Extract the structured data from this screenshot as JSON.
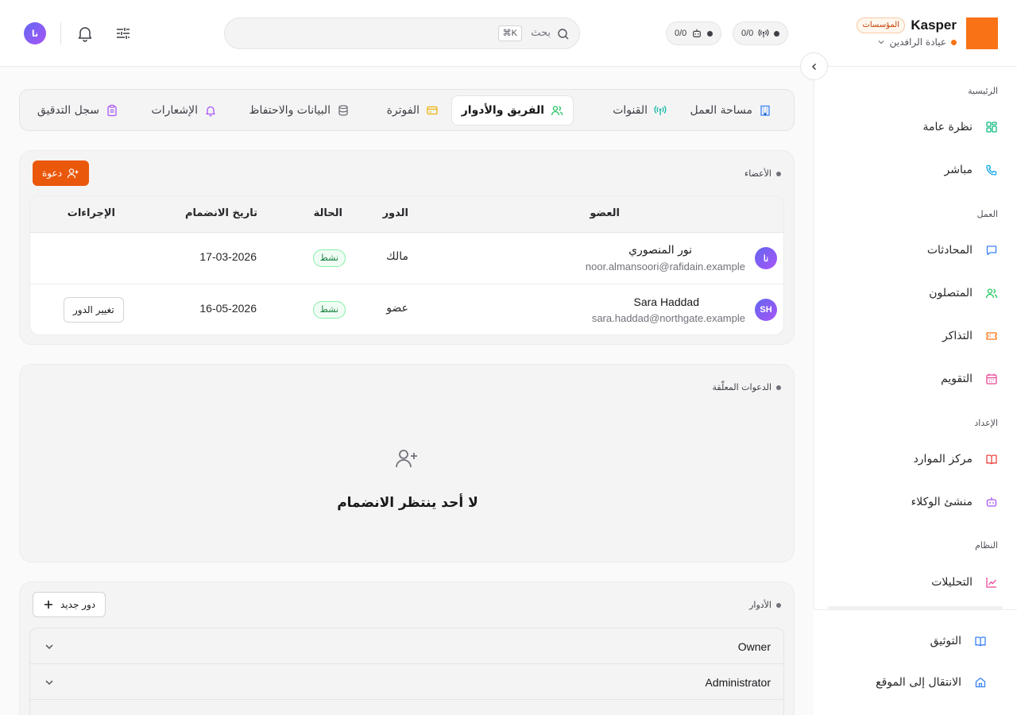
{
  "header": {
    "brand": "Kasper",
    "plan_badge": "المؤسسات",
    "clinic": "عيادة الرافدين",
    "pill_signal": "0/0",
    "pill_bot": "0/0",
    "search_placeholder": "بحث",
    "search_shortcut": "⌘K",
    "user_initials": "نا",
    "accent_color": "#f97316"
  },
  "sidebar": {
    "sections": [
      {
        "label": "الرئيسية"
      },
      {
        "label": "العمل"
      },
      {
        "label": "الإعداد"
      },
      {
        "label": "النظام"
      }
    ],
    "items": [
      {
        "label": "نظرة عامة",
        "icon": "grid-icon"
      },
      {
        "label": "مباشر",
        "icon": "phone-icon"
      },
      {
        "label": "المحادثات",
        "icon": "chat-icon"
      },
      {
        "label": "المتصلون",
        "icon": "users-icon"
      },
      {
        "label": "التذاكر",
        "icon": "ticket-icon"
      },
      {
        "label": "التقويم",
        "icon": "calendar-icon"
      },
      {
        "label": "مركز الموارد",
        "icon": "book-icon"
      },
      {
        "label": "منشئ الوكلاء",
        "icon": "bot-icon"
      },
      {
        "label": "التحليلات",
        "icon": "chart-icon"
      }
    ],
    "footer": [
      {
        "label": "التوثيق",
        "icon": "book-open-icon"
      },
      {
        "label": "الانتقال إلى الموقع",
        "icon": "home-icon"
      }
    ]
  },
  "tabs": [
    {
      "label": "مساحة العمل",
      "icon": "building-icon",
      "active": false
    },
    {
      "label": "القنوات",
      "icon": "antenna-icon",
      "active": false
    },
    {
      "label": "الفريق والأدوار",
      "icon": "users-icon",
      "active": true
    },
    {
      "label": "الفوترة",
      "icon": "credit-card-icon",
      "active": false
    },
    {
      "label": "البيانات والاحتفاظ",
      "icon": "database-icon",
      "active": false
    },
    {
      "label": "الإشعارات",
      "icon": "bell-icon",
      "active": false
    },
    {
      "label": "سجل التدقيق",
      "icon": "clipboard-icon",
      "active": false
    }
  ],
  "members": {
    "title": "الأعضاء",
    "invite_label": "دعوة",
    "columns": [
      "العضو",
      "الدور",
      "الحالة",
      "تاريخ الانضمام",
      "الإجراءات"
    ],
    "rows": [
      {
        "initials": "نا",
        "name": "نور المنصوري",
        "email": "noor.almansoori@rafidain.example",
        "role": "مالك",
        "status": "نشط",
        "joined": "17-03-2026",
        "action": ""
      },
      {
        "initials": "SH",
        "name": "Sara Haddad",
        "email": "sara.haddad@northgate.example",
        "role": "عضو",
        "status": "نشط",
        "joined": "16-05-2026",
        "action": "تغيير الدور"
      }
    ]
  },
  "pending": {
    "title": "الدعوات المعلّقة",
    "empty_text": "لا أحد ينتظر الانضمام"
  },
  "roles": {
    "title": "الأدوار",
    "new_role_label": "دور جديد",
    "items": [
      {
        "name": "Owner"
      },
      {
        "name": "Administrator"
      }
    ]
  }
}
